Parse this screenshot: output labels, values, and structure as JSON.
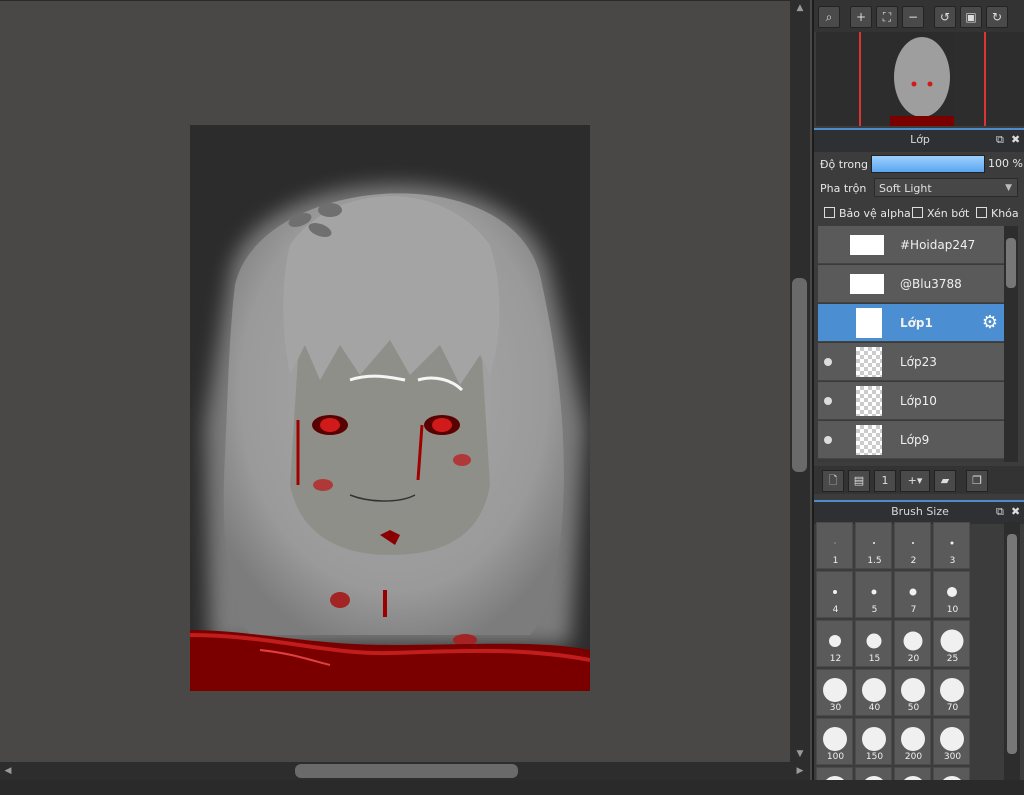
{
  "layer_panel": {
    "title": "Lớp",
    "opacity_label": "Độ trong",
    "opacity_value": "100 %",
    "blend_label": "Pha trộn",
    "blend_value": "Soft Light",
    "checkboxes": [
      "Bảo vệ alpha",
      "Xén bớt",
      "Khóa"
    ],
    "layers": [
      {
        "name": "#Hoidap247",
        "visible": false,
        "selected": false
      },
      {
        "name": "@Blu3788",
        "visible": false,
        "selected": false
      },
      {
        "name": "Lớp1",
        "visible": false,
        "selected": true
      },
      {
        "name": "Lớp23",
        "visible": true,
        "selected": false
      },
      {
        "name": "Lớp10",
        "visible": true,
        "selected": false
      },
      {
        "name": "Lớp9",
        "visible": true,
        "selected": false
      }
    ]
  },
  "brush_panel": {
    "title": "Brush Size",
    "sizes": [
      "1",
      "1.5",
      "2",
      "3",
      "4",
      "5",
      "7",
      "10",
      "12",
      "15",
      "20",
      "25",
      "30",
      "40",
      "50",
      "70",
      "100",
      "150",
      "200",
      "300"
    ]
  },
  "navigator": {
    "toolbar_icons": [
      "zoom-fit-icon",
      "zoom-in-icon",
      "fit-screen-icon",
      "zoom-out-icon",
      "rotate-left-icon",
      "actual-size-icon",
      "rotate-right-icon"
    ]
  },
  "colors": {
    "accent": "#4b8ed1",
    "opacity_bar": "#6ab4f5",
    "nav_marker": "#dd3333"
  }
}
